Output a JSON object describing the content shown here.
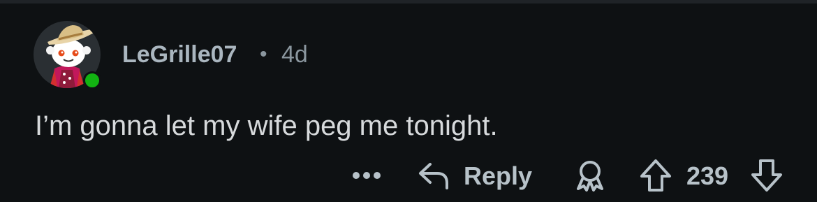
{
  "comment": {
    "author": "LeGrille07",
    "separator": "•",
    "age": "4d",
    "text": "I’m gonna let my wife peg me tonight.",
    "author_online": true
  },
  "actions": {
    "more_icon": "more-horizontal-icon",
    "reply_icon": "reply-arrow-icon",
    "reply_label": "Reply",
    "award_icon": "award-icon",
    "upvote_icon": "upvote-arrow-icon",
    "vote_count": "239",
    "downvote_icon": "downvote-arrow-icon"
  },
  "colors": {
    "background": "#0e1113",
    "username": "#aab6bf",
    "meta": "#8a969e",
    "body_text": "#d7dadc",
    "action_text": "#b7c2c9",
    "online_dot": "#12b312"
  }
}
